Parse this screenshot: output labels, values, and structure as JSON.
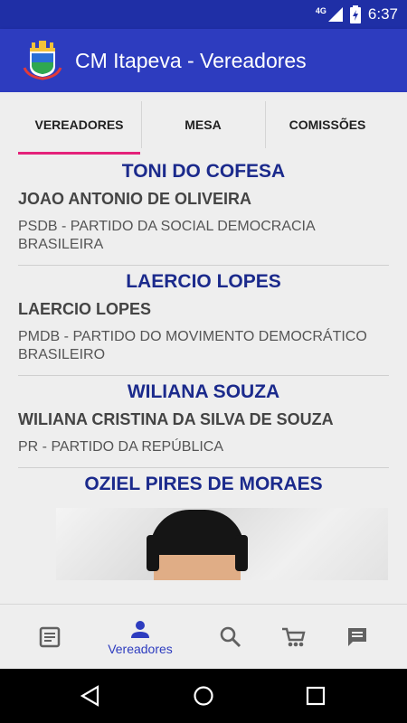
{
  "status_bar": {
    "network": "4G",
    "time": "6:37"
  },
  "app_bar": {
    "title": "CM Itapeva - Vereadores"
  },
  "tabs": [
    {
      "label": "VEREADORES",
      "selected": true
    },
    {
      "label": "MESA",
      "selected": false
    },
    {
      "label": "COMISSÕES",
      "selected": false
    }
  ],
  "councilors": [
    {
      "nickname": "TONI DO COFESA",
      "full_name": "JOAO ANTONIO DE OLIVEIRA",
      "party": "PSDB - PARTIDO DA SOCIAL DEMOCRACIA BRASILEIRA"
    },
    {
      "nickname": "LAERCIO LOPES",
      "full_name": "LAERCIO LOPES",
      "party": "PMDB - PARTIDO DO MOVIMENTO DEMOCRÁTICO BRASILEIRO"
    },
    {
      "nickname": "WILIANA SOUZA",
      "full_name": "WILIANA CRISTINA DA SILVA DE SOUZA",
      "party": "PR - PARTIDO DA REPÚBLICA"
    },
    {
      "nickname": "OZIEL PIRES DE MORAES"
    }
  ],
  "bottom_nav": [
    {
      "icon": "news-icon",
      "label": ""
    },
    {
      "icon": "person-icon",
      "label": "Vereadores",
      "selected": true
    },
    {
      "icon": "search-icon",
      "label": ""
    },
    {
      "icon": "cart-icon",
      "label": ""
    },
    {
      "icon": "chat-icon",
      "label": ""
    }
  ],
  "colors": {
    "primary": "#2d3cbf",
    "primary_dark": "#1f2fa6",
    "accent": "#e4217a",
    "nickname": "#1b2a8c"
  }
}
